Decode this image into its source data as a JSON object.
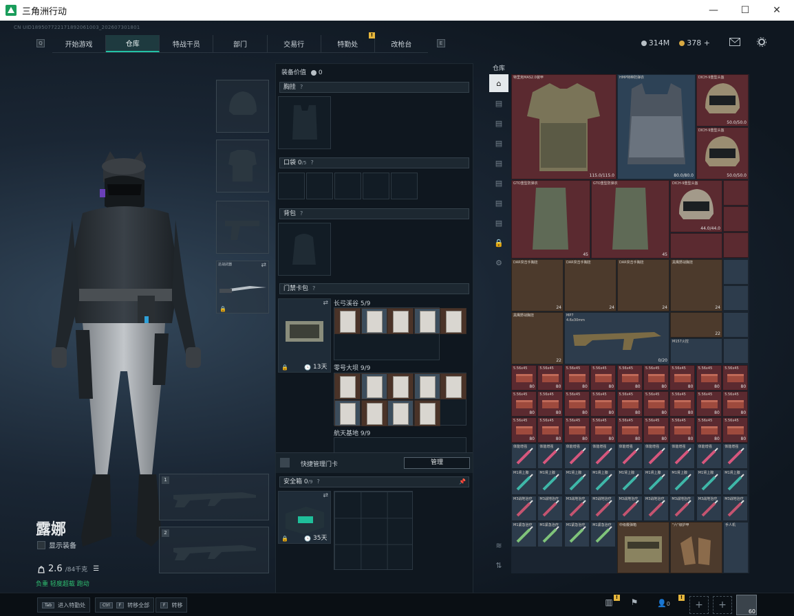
{
  "window": {
    "title": "三角洲行动",
    "min": "—",
    "max": "☐",
    "close": "✕"
  },
  "uid": "CN UID18950772217189206100​3_202607301801",
  "nav": {
    "left_key": "Q",
    "right_key": "E",
    "tabs": [
      {
        "label": "开始游戏",
        "active": false
      },
      {
        "label": "仓库",
        "active": true
      },
      {
        "label": "特战干员",
        "active": false
      },
      {
        "label": "部门",
        "active": false
      },
      {
        "label": "交易行",
        "active": false
      },
      {
        "label": "特勤处",
        "active": false,
        "badge": "!"
      },
      {
        "label": "改枪台",
        "active": false
      }
    ]
  },
  "currency": {
    "silver": "314M",
    "gold": "378",
    "plus": "+"
  },
  "character": {
    "name": "露娜",
    "show_equip": "显示装备",
    "weight": "2.6",
    "weight_max": "/84千克",
    "status": "负重 轻度超载 跑动"
  },
  "loadout": {
    "melee_label": "近战武器",
    "slot1": "1",
    "slot2": "2"
  },
  "equipment": {
    "value_label": "装备价值",
    "value": "0",
    "chest_rig": "胸挂",
    "pockets": "口袋",
    "pockets_count": "0",
    "pockets_max": "/5",
    "backpack": "背包",
    "keycard": "门禁卡包",
    "keycard_timer": "13天",
    "maps": [
      {
        "name": "长弓溪谷",
        "count": "5/9"
      },
      {
        "name": "零号大坝",
        "count": "9/9"
      },
      {
        "name": "航天基地",
        "count": "9/9"
      }
    ],
    "quick_manage": "快捷管理门卡",
    "manage_btn": "管理",
    "safebox": "安全箱",
    "safebox_count": "0",
    "safebox_max": "/9",
    "safebox_timer": "35天",
    "help": "?"
  },
  "warehouse": {
    "title": "仓库"
  },
  "items_top": [
    {
      "name": "特里克MAS2.0装甲",
      "value": "115.0/115.0"
    },
    {
      "name": "HMP特种防弹衣",
      "value": "80.0/80.0"
    },
    {
      "name": "DICH-9重型头盔",
      "value": "50.0/50.0"
    },
    {
      "name": "DICH-9重型头盔",
      "value": "50.0/50.0"
    },
    {
      "name": "GTO重型防弹衣",
      "value": "45"
    },
    {
      "name": "GTO重型防弹衣",
      "value": "45"
    },
    {
      "name": "DICH-9重型头盔",
      "value": "44.0/44.0"
    },
    {
      "name": "DAR突击手胸挂",
      "value": "24"
    },
    {
      "name": "DAR突击手胸挂",
      "value": "24"
    },
    {
      "name": "DAR突击手胸挂",
      "value": "24"
    },
    {
      "name": "黑鹰野战胸挂",
      "value": "24"
    },
    {
      "name": "黑鹰野战胸挂",
      "value": "22"
    },
    {
      "name": "黑鹰野战胸挂",
      "value": "22"
    },
    {
      "name": "MP7",
      "value": "0/20"
    },
    {
      "name": "M157火控",
      "value": ""
    }
  ],
  "mp7_sub": "4.6x30mm",
  "ammo_value": "80",
  "ammo_label": "5.56x45",
  "med_labels": [
    "体能增强",
    "M1肾上腺",
    "M3战地治疗",
    "D·V止痛药",
    "M1紧急治疗",
    "中级霰弹箱",
    "\"六\"级护甲",
    "手人机"
  ],
  "med_count": "5",
  "bottom": {
    "tab_key": "Tab",
    "tab_label": "进入特勤处",
    "ctrl_key": "Ctrl",
    "f_key": "F",
    "ctrl_label": "转移全部",
    "f_label": "转移",
    "friends": "0",
    "level": "60"
  },
  "colors": {
    "accent": "#23c2a6",
    "badge": "#e6b63c",
    "red_bg": "#5b2a30",
    "brown_bg": "#4c3a2c"
  }
}
